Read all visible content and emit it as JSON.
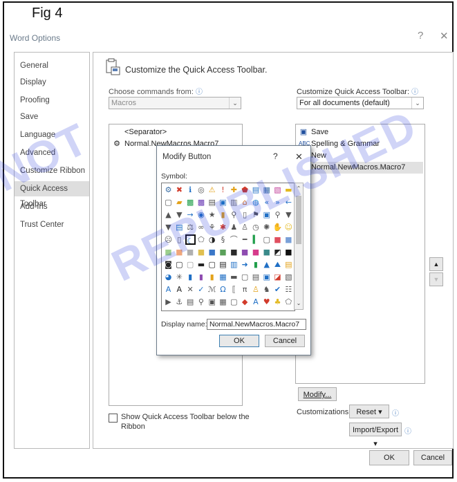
{
  "figure_label": "Fig 4",
  "window": {
    "title": "Word Options",
    "help_glyph": "?",
    "close_glyph": "✕"
  },
  "nav": {
    "items": [
      {
        "label": "General",
        "selected": false
      },
      {
        "label": "Display",
        "selected": false
      },
      {
        "label": "Proofing",
        "selected": false
      },
      {
        "label": "Save",
        "selected": false
      },
      {
        "label": "Language",
        "selected": false
      },
      {
        "label": "Advanced",
        "selected": false
      },
      {
        "label": "Customize Ribbon",
        "selected": false
      },
      {
        "label": "Quick Access Toolbar",
        "selected": true
      },
      {
        "label": "Add-Ins",
        "selected": false
      },
      {
        "label": "Trust Center",
        "selected": false
      }
    ]
  },
  "main": {
    "heading": "Customize the Quick Access Toolbar.",
    "choose_label": "Choose commands from:",
    "choose_value": "Macros",
    "customize_label": "Customize Quick Access Toolbar:",
    "customize_value": "For all documents (default)",
    "commands_list": [
      {
        "label": "<Separator>",
        "icon": ""
      },
      {
        "label": "Normal.NewMacros.Macro7",
        "icon": "macro-icon"
      }
    ],
    "toolbar_list": [
      {
        "label": "Save",
        "icon": "save-icon"
      },
      {
        "label": "Spelling & Grammar",
        "icon": "spelling-icon"
      },
      {
        "label": "New",
        "icon": "new-document-icon"
      },
      {
        "label": "Normal.NewMacros.Macro7",
        "icon": "macro-icon",
        "highlighted": true
      }
    ],
    "move_up_glyph": "▲",
    "move_down_glyph": "▼",
    "modify_label": "Modify...",
    "customizations_label": "Customizations:",
    "reset_label": "Reset ▾",
    "import_export_label": "Import/Export ▾",
    "show_below_label_line1": "Show Quick Access Toolbar below the",
    "show_below_label_line2": "Ribbon",
    "ok_label": "OK",
    "cancel_label": "Cancel"
  },
  "modify_dialog": {
    "title": "Modify Button",
    "help_glyph": "?",
    "close_glyph": "✕",
    "symbol_label": "Symbol:",
    "display_name_label": "Display name:",
    "display_name_value": "Normal.NewMacros.Macro7",
    "ok_label": "OK",
    "cancel_label": "Cancel",
    "symbol_rows": [
      [
        {
          "g": "⚙",
          "c": "#3a6ea5"
        },
        {
          "g": "✖",
          "c": "#d23b2b"
        },
        {
          "g": "ℹ",
          "c": "#1f6fc5"
        },
        {
          "g": "◎",
          "c": "#555"
        },
        {
          "g": "⚠",
          "c": "#e3a21a"
        },
        {
          "g": "!",
          "c": "#d23b2b"
        },
        {
          "g": "✚",
          "c": "#e3a21a"
        },
        {
          "g": "⬟",
          "c": "#d23b2b"
        },
        {
          "g": "▤",
          "c": "#1f6fc5"
        },
        {
          "g": "▦",
          "c": "#3a6ea5"
        },
        {
          "g": "▧",
          "c": "#c2419a"
        },
        {
          "g": "▬",
          "c": "#e3b920"
        }
      ],
      [
        {
          "g": "▢",
          "c": "#555"
        },
        {
          "g": "▰",
          "c": "#e3a21a"
        },
        {
          "g": "▩",
          "c": "#1f9e4a"
        },
        {
          "g": "▩",
          "c": "#6a3bb5"
        },
        {
          "g": "▤",
          "c": "#555"
        },
        {
          "g": "▣",
          "c": "#1f6fc5"
        },
        {
          "g": "▥",
          "c": "#777"
        },
        {
          "g": "⌂",
          "c": "#d2691e"
        },
        {
          "g": "◍",
          "c": "#2a8ad0"
        },
        {
          "g": "«",
          "c": "#1f6fc5"
        },
        {
          "g": "»",
          "c": "#1f6fc5"
        },
        {
          "g": "←",
          "c": "#1f6fc5"
        }
      ],
      [
        {
          "g": "▲",
          "c": "#555"
        },
        {
          "g": "▼",
          "c": "#555"
        },
        {
          "g": "→",
          "c": "#1f6fc5"
        },
        {
          "g": "◉",
          "c": "#1f6fc5"
        },
        {
          "g": "★",
          "c": "#555"
        },
        {
          "g": "▮",
          "c": "#e3a21a"
        },
        {
          "g": "⚲",
          "c": "#555"
        },
        {
          "g": "▯",
          "c": "#555"
        },
        {
          "g": "⚑",
          "c": "#555"
        },
        {
          "g": "▣",
          "c": "#1f6fc5"
        },
        {
          "g": "⚲",
          "c": "#555"
        },
        {
          "g": "▼",
          "c": "#555"
        }
      ],
      [
        {
          "g": "▼",
          "c": "#555"
        },
        {
          "g": "▤",
          "c": "#1f6fc5"
        },
        {
          "g": "⚖",
          "c": "#555"
        },
        {
          "g": "∞",
          "c": "#555"
        },
        {
          "g": "⚘",
          "c": "#555"
        },
        {
          "g": "✱",
          "c": "#d23b2b"
        },
        {
          "g": "♟",
          "c": "#555"
        },
        {
          "g": "♙",
          "c": "#555"
        },
        {
          "g": "◷",
          "c": "#555"
        },
        {
          "g": "✺",
          "c": "#555"
        },
        {
          "g": "✋",
          "c": "#555"
        },
        {
          "g": "☺",
          "c": "#e3b920"
        }
      ],
      [
        {
          "g": "☹",
          "c": "#555"
        },
        {
          "g": "▯",
          "c": "#555"
        },
        {
          "g": "☾",
          "c": "#1f6fc5"
        },
        {
          "g": "⬠",
          "c": "#555"
        },
        {
          "g": "◑",
          "c": "#222"
        },
        {
          "g": "§",
          "c": "#555"
        },
        {
          "g": "⌒",
          "c": "#555"
        },
        {
          "g": "━",
          "c": "#555"
        },
        {
          "g": "▍",
          "c": "#1f9e4a"
        },
        {
          "g": "▢",
          "c": "#555"
        },
        {
          "g": "■",
          "c": "#e04f5f"
        },
        {
          "g": "■",
          "c": "#7aa0d8"
        }
      ],
      [
        {
          "g": "■",
          "c": "#9ccf8c"
        },
        {
          "g": "■",
          "c": "#f0a77c"
        },
        {
          "g": "■",
          "c": "#b0b0b0"
        },
        {
          "g": "■",
          "c": "#e0c050"
        },
        {
          "g": "■",
          "c": "#3a77c8"
        },
        {
          "g": "■",
          "c": "#5aa05a"
        },
        {
          "g": "■",
          "c": "#2a2a2a"
        },
        {
          "g": "■",
          "c": "#8e4cb0"
        },
        {
          "g": "■",
          "c": "#d63a8a"
        },
        {
          "g": "■",
          "c": "#3a8a8a"
        },
        {
          "g": "◩",
          "c": "#222"
        },
        {
          "g": "■",
          "c": "#111"
        }
      ],
      [
        {
          "g": "◙",
          "c": "#222"
        },
        {
          "g": "▢",
          "c": "#222"
        },
        {
          "g": "▢",
          "c": "#999"
        },
        {
          "g": "▬",
          "c": "#222"
        },
        {
          "g": "▢",
          "c": "#222"
        },
        {
          "g": "▤",
          "c": "#222"
        },
        {
          "g": "▥",
          "c": "#1f6fc5"
        },
        {
          "g": "➜",
          "c": "#1f6fc5"
        },
        {
          "g": "▮",
          "c": "#1f9e4a"
        },
        {
          "g": "▲",
          "c": "#1f6fc5"
        },
        {
          "g": "⛰",
          "c": "#1f6fc5"
        },
        {
          "g": "▤",
          "c": "#e3a21a"
        }
      ],
      [
        {
          "g": "◕",
          "c": "#1f6fc5"
        },
        {
          "g": "✳",
          "c": "#555"
        },
        {
          "g": "▮",
          "c": "#1f6fc5"
        },
        {
          "g": "▮",
          "c": "#8e4cb0"
        },
        {
          "g": "▮",
          "c": "#e3a21a"
        },
        {
          "g": "▦",
          "c": "#1f6fc5"
        },
        {
          "g": "▬",
          "c": "#555"
        },
        {
          "g": "▢",
          "c": "#555"
        },
        {
          "g": "▤",
          "c": "#555"
        },
        {
          "g": "▣",
          "c": "#1f6fc5"
        },
        {
          "g": "◪",
          "c": "#d23b2b"
        },
        {
          "g": "▧",
          "c": "#555"
        }
      ],
      [
        {
          "g": "A",
          "c": "#1f6fc5"
        },
        {
          "g": "A",
          "c": "#222"
        },
        {
          "g": "✕",
          "c": "#555"
        },
        {
          "g": "✓",
          "c": "#1f6fc5"
        },
        {
          "g": "ℳ",
          "c": "#555"
        },
        {
          "g": "Ω",
          "c": "#1f6fc5"
        },
        {
          "g": "⟦",
          "c": "#555"
        },
        {
          "g": "π",
          "c": "#555"
        },
        {
          "g": "♙",
          "c": "#e3a21a"
        },
        {
          "g": "♞",
          "c": "#555"
        },
        {
          "g": "✔",
          "c": "#1f6fc5"
        },
        {
          "g": "☷",
          "c": "#555"
        }
      ],
      [
        {
          "g": "▶",
          "c": "#555"
        },
        {
          "g": "⚓",
          "c": "#555"
        },
        {
          "g": "▤",
          "c": "#555"
        },
        {
          "g": "⚲",
          "c": "#555"
        },
        {
          "g": "▣",
          "c": "#555"
        },
        {
          "g": "▦",
          "c": "#555"
        },
        {
          "g": "▢",
          "c": "#555"
        },
        {
          "g": "◆",
          "c": "#d23b2b"
        },
        {
          "g": "A",
          "c": "#1f6fc5"
        },
        {
          "g": "♥",
          "c": "#d23b2b"
        },
        {
          "g": "♣",
          "c": "#e3b920"
        },
        {
          "g": "⬠",
          "c": "#555"
        }
      ]
    ],
    "selected_symbol": {
      "row": 4,
      "col": 2
    }
  },
  "watermarks": [
    "REPUBLISHED",
    "NOT"
  ]
}
